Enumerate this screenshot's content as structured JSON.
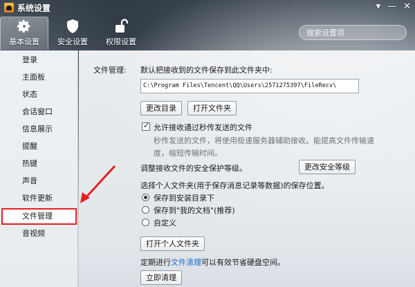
{
  "window": {
    "title": "系统设置",
    "controls": [
      "▾",
      "—",
      "✕"
    ]
  },
  "tabs": [
    {
      "label": "基本设置",
      "icon": "gear-icon",
      "active": true
    },
    {
      "label": "安全设置",
      "icon": "shield-icon",
      "active": false
    },
    {
      "label": "权限设置",
      "icon": "lock-icon",
      "active": false
    }
  ],
  "search": {
    "placeholder": "搜索设置项",
    "icon": "search-icon"
  },
  "sidebar": {
    "items": [
      {
        "label": "登录"
      },
      {
        "label": "主面板"
      },
      {
        "label": "状态"
      },
      {
        "label": "会话窗口"
      },
      {
        "label": "信息展示"
      },
      {
        "label": "提醒"
      },
      {
        "label": "热键"
      },
      {
        "label": "声音"
      },
      {
        "label": "软件更新"
      },
      {
        "label": "文件管理",
        "active": true,
        "highlight_color": "#e02020"
      },
      {
        "label": "音视频"
      }
    ]
  },
  "file_management": {
    "section_label": "文件管理:",
    "default_path_desc": "默认把接收到的文件保存到此文件夹中:",
    "path_value": "C:\\Program Files\\Tencent\\QQ\\Users\\2571275397\\FileRecv\\",
    "change_dir_button": "更改目录",
    "open_folder_button": "打开文件夹",
    "allow_second_transfer": {
      "checked": true,
      "label": "允许接收通过秒传发送的文件",
      "desc_line1": "秒传发送的文件，将使用极速服务器辅助接收。能提高文件传输速",
      "desc_line2": "度，缩短传输时间。"
    },
    "security_level_text": "调整接收文件的安全保护等级。",
    "change_security_button": "更改安全等级",
    "personal_folder_text": "选择个人文件夹(用于保存消息记录等数据)的保存位置。",
    "radio_options": [
      {
        "label": "保存到安装目录下",
        "selected": true
      },
      {
        "label": "保存到\"我的文档\"(推荐)",
        "selected": false
      },
      {
        "label": "自定义",
        "selected": false
      }
    ],
    "open_personal_folder_button": "打开个人文件夹",
    "cleanup_prefix": "定期进行",
    "cleanup_link": "文件清理",
    "cleanup_suffix": "可以有效节省硬盘空间。",
    "cleanup_now_button": "立即清理"
  },
  "annotation": {
    "arrow_color": "#e02020"
  }
}
